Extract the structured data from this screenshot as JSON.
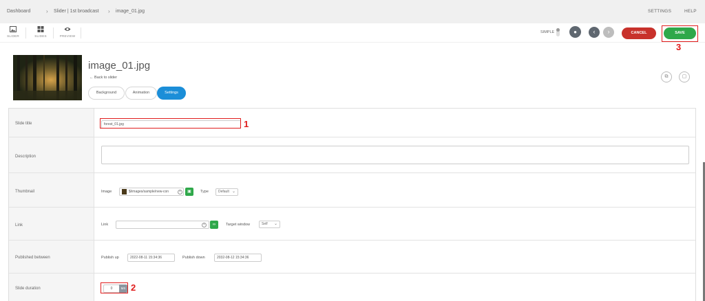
{
  "breadcrumb": {
    "items": [
      "Dashboard",
      "Slider | 1st broadcast",
      "image_01.jpg"
    ]
  },
  "top_links": {
    "settings": "SETTINGS",
    "help": "HELP"
  },
  "toolbar": {
    "tools": [
      {
        "label": "SLIDER",
        "icon": "image-icon"
      },
      {
        "label": "SLIDES",
        "icon": "grid-icon"
      },
      {
        "label": "PREVIEW",
        "icon": "eye-icon"
      }
    ],
    "simple_label": "SIMPLE",
    "cancel_label": "CANCEL",
    "save_label": "SAVE"
  },
  "header": {
    "title": "image_01.jpg",
    "back_link": "Back to slider",
    "tabs": [
      {
        "label": "Background",
        "active": false
      },
      {
        "label": "Animation",
        "active": false
      },
      {
        "label": "Settings",
        "active": true
      }
    ]
  },
  "annotations": {
    "n1": "1",
    "n2": "2",
    "n3": "3"
  },
  "form": {
    "slide_title": {
      "label": "Slide title",
      "value": "forest_01.jpg"
    },
    "description": {
      "label": "Description",
      "value": ""
    },
    "thumbnail": {
      "label": "Thumbnail",
      "image_label": "Image",
      "image_path": "$/images/sample/new-con",
      "type_label": "Type",
      "type_value": "Default"
    },
    "link": {
      "label": "Link",
      "link_label": "Link",
      "link_value": "",
      "target_label": "Target window",
      "target_value": "Self"
    },
    "published": {
      "label": "Published between",
      "up_label": "Publish up",
      "up_value": "2022-08-11 15:34:36",
      "down_label": "Publish down",
      "down_value": "2032-08-12 15:34:36"
    },
    "duration": {
      "label": "Slide duration",
      "value": "0",
      "unit": "MS"
    }
  },
  "colors": {
    "accent_blue": "#1b8ed8",
    "cancel_red": "#c8312b",
    "save_green": "#2fa84a",
    "annotation_red": "#e01b1b"
  }
}
